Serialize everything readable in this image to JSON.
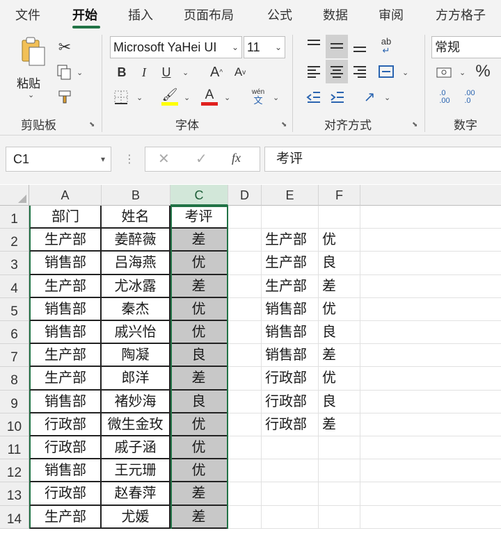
{
  "ribbon_tabs": [
    "文件",
    "开始",
    "插入",
    "页面布局",
    "公式",
    "数据",
    "审阅",
    "方方格子"
  ],
  "active_tab": "开始",
  "clipboard": {
    "paste_label": "粘贴",
    "group_label": "剪贴板"
  },
  "font": {
    "name": "Microsoft YaHei UI",
    "size": "11",
    "group_label": "字体",
    "bold": "B",
    "italic": "I",
    "underline": "U",
    "grow": "A",
    "shrink": "A",
    "color_letter": "A",
    "phonetic_top": "wén",
    "phonetic_bottom": "文"
  },
  "alignment": {
    "group_label": "对齐方式",
    "wrap_icon_text": "ab"
  },
  "number": {
    "format": "常规",
    "group_label": "数字",
    "percent": "%",
    "inc_decimal": ".0\n.00",
    "dec_decimal": ".00\n.0"
  },
  "formula_bar": {
    "name_box": "C1",
    "fx": "fx",
    "content": "考评"
  },
  "columns": [
    "A",
    "B",
    "C",
    "D",
    "E",
    "F"
  ],
  "selected_column": "C",
  "rows": [
    {
      "n": "1",
      "A": "部门",
      "B": "姓名",
      "C": "考评",
      "E": "",
      "F": ""
    },
    {
      "n": "2",
      "A": "生产部",
      "B": "姜醉薇",
      "C": "差",
      "E": "生产部",
      "F": "优"
    },
    {
      "n": "3",
      "A": "销售部",
      "B": "吕海燕",
      "C": "优",
      "E": "生产部",
      "F": "良"
    },
    {
      "n": "4",
      "A": "生产部",
      "B": "尤冰露",
      "C": "差",
      "E": "生产部",
      "F": "差"
    },
    {
      "n": "5",
      "A": "销售部",
      "B": "秦杰",
      "C": "优",
      "E": "销售部",
      "F": "优"
    },
    {
      "n": "6",
      "A": "销售部",
      "B": "戚兴怡",
      "C": "优",
      "E": "销售部",
      "F": "良"
    },
    {
      "n": "7",
      "A": "生产部",
      "B": "陶凝",
      "C": "良",
      "E": "销售部",
      "F": "差"
    },
    {
      "n": "8",
      "A": "生产部",
      "B": "郎洋",
      "C": "差",
      "E": "行政部",
      "F": "优"
    },
    {
      "n": "9",
      "A": "销售部",
      "B": "褚妙海",
      "C": "良",
      "E": "行政部",
      "F": "良"
    },
    {
      "n": "10",
      "A": "行政部",
      "B": "微生金玫",
      "C": "优",
      "E": "行政部",
      "F": "差"
    },
    {
      "n": "11",
      "A": "行政部",
      "B": "戚子涵",
      "C": "优",
      "E": "",
      "F": ""
    },
    {
      "n": "12",
      "A": "销售部",
      "B": "王元珊",
      "C": "优",
      "E": "",
      "F": ""
    },
    {
      "n": "13",
      "A": "行政部",
      "B": "赵春萍",
      "C": "差",
      "E": "",
      "F": ""
    },
    {
      "n": "14",
      "A": "生产部",
      "B": "尤媛",
      "C": "差",
      "E": "",
      "F": ""
    }
  ]
}
